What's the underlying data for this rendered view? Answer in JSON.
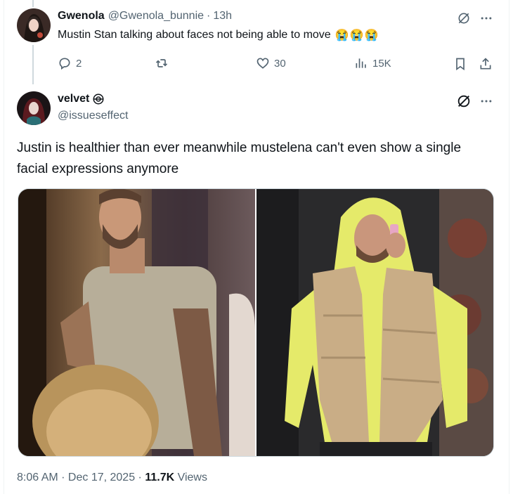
{
  "reply_tweet": {
    "author_name": "Gwenola",
    "handle": "@Gwenola_bunnie",
    "separator": "·",
    "time": "13h",
    "text": "Mustin Stan talking about faces not being able to move",
    "emojis": "😭😭😭",
    "actions": {
      "replies": "2",
      "reposts": "",
      "likes": "30",
      "views": "15K"
    }
  },
  "main_tweet": {
    "author_name": "velvet",
    "handle": "@issueseffect",
    "text": "Justin is healthier than ever meanwhile mustelena can't even show a single facial expressions anymore",
    "timestamp": "8:06 AM · Dec 17, 2025 ·",
    "views_count": "11.7K",
    "views_label": "Views"
  },
  "icons": [
    "reply-icon",
    "repost-icon",
    "like-icon",
    "views-icon",
    "bookmark-icon",
    "share-icon",
    "grok-icon",
    "more-icon",
    "verified-badge-icon"
  ],
  "colors": {
    "muted": "#536471",
    "text": "#0f1419",
    "border": "#cfd9de",
    "hoodie": "#e5ea6a",
    "vest": "#c9ad86"
  }
}
